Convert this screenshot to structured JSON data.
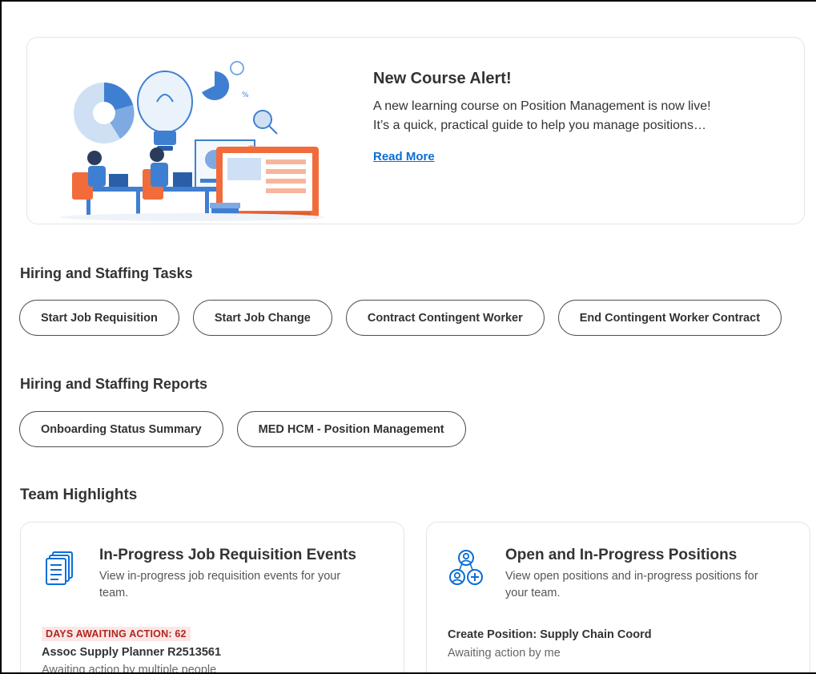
{
  "banner": {
    "title": "New Course Alert!",
    "body_line1": "A new learning course on Position Management is now live!",
    "body_line2": "It’s a quick, practical guide to help you manage positions…",
    "read_more": "Read More"
  },
  "tasks": {
    "title": "Hiring and Staffing Tasks",
    "buttons": [
      "Start Job Requisition",
      "Start Job Change",
      "Contract Contingent Worker",
      "End Contingent Worker Contract"
    ]
  },
  "reports": {
    "title": "Hiring and Staffing Reports",
    "buttons": [
      "Onboarding Status Summary",
      "MED HCM - Position Management"
    ]
  },
  "highlights": {
    "title": "Team Highlights",
    "cards": [
      {
        "title": "In-Progress Job Requisition Events",
        "description": "View in-progress job requisition events for your team.",
        "badge": "DAYS AWAITING ACTION: 62",
        "item_title": "Assoc Supply Planner R2513561",
        "item_sub": "Awaiting action by multiple people",
        "icon": "documents-icon"
      },
      {
        "title": "Open and In-Progress Positions",
        "description": "View open positions and in-progress positions for your team.",
        "item_title": "Create Position: Supply Chain Coord",
        "item_sub": "Awaiting action by me",
        "icon": "people-add-icon"
      }
    ]
  },
  "colors": {
    "accent_blue": "#0b6ed6",
    "badge_bg": "#fbe7e6",
    "badge_text": "#b0261e",
    "illustration_blue": "#3f7fd1",
    "illustration_orange": "#f26b3a"
  }
}
